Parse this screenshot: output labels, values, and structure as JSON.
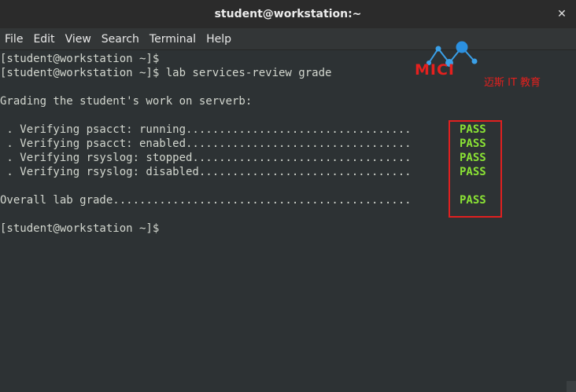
{
  "window": {
    "title": "student@workstation:~",
    "close_glyph": "✕"
  },
  "menu": [
    "File",
    "Edit",
    "View",
    "Search",
    "Terminal",
    "Help"
  ],
  "terminal": {
    "lines": [
      "[student@workstation ~]$",
      "[student@workstation ~]$ lab services-review grade",
      "",
      "Grading the student's work on serverb:",
      "",
      " . Verifying psacct: running..................................",
      " . Verifying psacct: enabled..................................",
      " . Verifying rsyslog: stopped.................................",
      " . Verifying rsyslog: disabled................................",
      "",
      "Overall lab grade.............................................",
      "",
      "[student@workstation ~]$"
    ],
    "results": [
      "PASS",
      "PASS",
      "PASS",
      "PASS",
      "PASS"
    ]
  },
  "watermark": {
    "brand": "MICI",
    "subtitle": "迈斯 IT 教育"
  },
  "colors": {
    "terminal_bg": "#2d3234",
    "text": "#d3d7cf",
    "pass": "#8ae234",
    "highlight": "#e02020",
    "brand": "#e5201e"
  }
}
